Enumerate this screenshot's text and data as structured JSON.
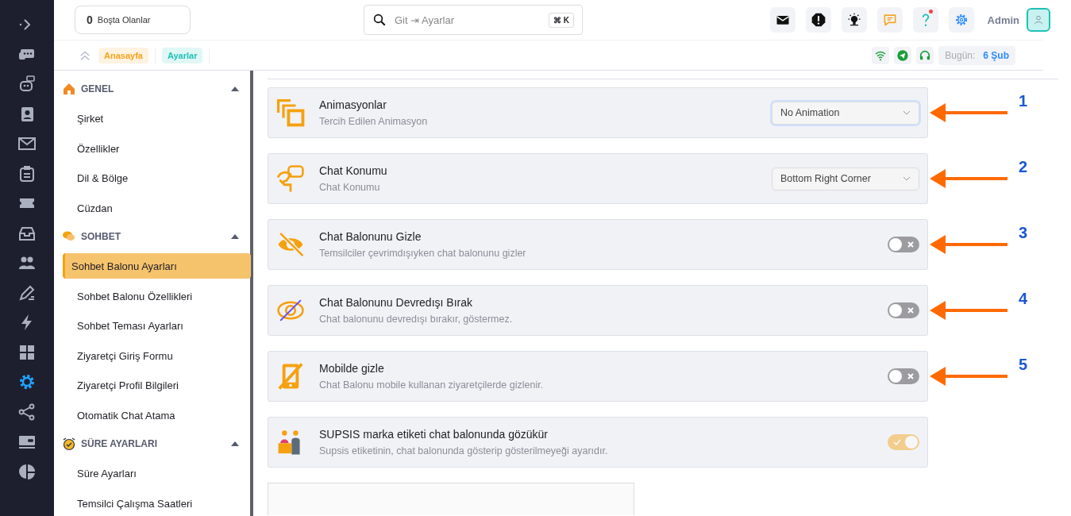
{
  "rail": [
    {
      "selected": false
    },
    {
      "selected": false
    },
    {
      "selected": false
    },
    {
      "selected": false
    },
    {
      "selected": false
    },
    {
      "selected": false
    },
    {
      "selected": false
    },
    {
      "selected": false
    },
    {
      "selected": false
    },
    {
      "selected": false
    },
    {
      "selected": false
    },
    {
      "selected": false
    },
    {
      "selected": true
    },
    {
      "selected": false
    },
    {
      "selected": false
    },
    {
      "selected": false
    }
  ],
  "header": {
    "idle_count": "0",
    "idle_label": "Boşta Olanlar",
    "search": {
      "placeholder": "Git ⇥ Ayarlar",
      "shortcut": "⌘ K"
    },
    "actions": [
      {
        "badge": false
      },
      {
        "badge": false
      },
      {
        "badge": false
      },
      {
        "badge": false
      },
      {
        "badge": true
      },
      {
        "badge": false
      }
    ],
    "user": "Admin"
  },
  "breadcrumb": [
    {
      "label": "Anasayfa",
      "color": "#f7a21b"
    },
    {
      "label": "Ayarlar",
      "color": "#1fc1b5"
    }
  ],
  "status": {
    "today_label": "Bugün:",
    "today_value": "6 Şub"
  },
  "sidebar": [
    {
      "title": "GENEL",
      "expanded": true,
      "items": [
        {
          "label": "Şirket",
          "selected": false
        },
        {
          "label": "Özellikler",
          "selected": false
        },
        {
          "label": "Dil & Bölge",
          "selected": false
        },
        {
          "label": "Cüzdan",
          "selected": false
        }
      ]
    },
    {
      "title": "SOHBET",
      "expanded": true,
      "items": [
        {
          "label": "Sohbet Balonu Ayarları",
          "selected": true
        },
        {
          "label": "Sohbet Balonu Özellikleri",
          "selected": false
        },
        {
          "label": "Sohbet Teması Ayarları",
          "selected": false
        },
        {
          "label": "Ziyaretçi Giriş Formu",
          "selected": false
        },
        {
          "label": "Ziyaretçi Profil Bilgileri",
          "selected": false
        },
        {
          "label": "Otomatik Chat Atama",
          "selected": false
        }
      ]
    },
    {
      "title": "SÜRE AYARLARI",
      "expanded": true,
      "items": [
        {
          "label": "Süre Ayarları",
          "selected": false
        },
        {
          "label": "Temsilci Çalışma Saatleri",
          "selected": false
        }
      ]
    }
  ],
  "settings": [
    {
      "kind": "select",
      "title": "Animasyonlar",
      "description": "Tercih Edilen Animasyon",
      "value": "No Animation",
      "focused": true,
      "marker": "1"
    },
    {
      "kind": "select",
      "title": "Chat Konumu",
      "description": "Chat Konumu",
      "value": "Bottom Right Corner",
      "focused": false,
      "marker": "2"
    },
    {
      "kind": "toggle",
      "title": "Chat Balonunu Gizle",
      "description": "Temsilciler çevrimdışıyken chat balonunu gizler",
      "on": false,
      "disabled": false,
      "marker": "3"
    },
    {
      "kind": "toggle",
      "title": "Chat Balonunu Devredışı Bırak",
      "description": "Chat balonunu devredışı bırakır, göstermez.",
      "on": false,
      "disabled": false,
      "marker": "4"
    },
    {
      "kind": "toggle",
      "title": "Mobilde gizle",
      "description": "Chat Balonu mobile kullanan ziyaretçilerde gizlenir.",
      "on": false,
      "disabled": false,
      "marker": "5"
    },
    {
      "kind": "toggle",
      "title": "SUPSIS marka etiketi chat balonunda gözükür",
      "description": "Supsis etiketinin, chat balonunda gösterip gösterilmeyeği ayarıdır.",
      "on": true,
      "disabled": true
    }
  ]
}
